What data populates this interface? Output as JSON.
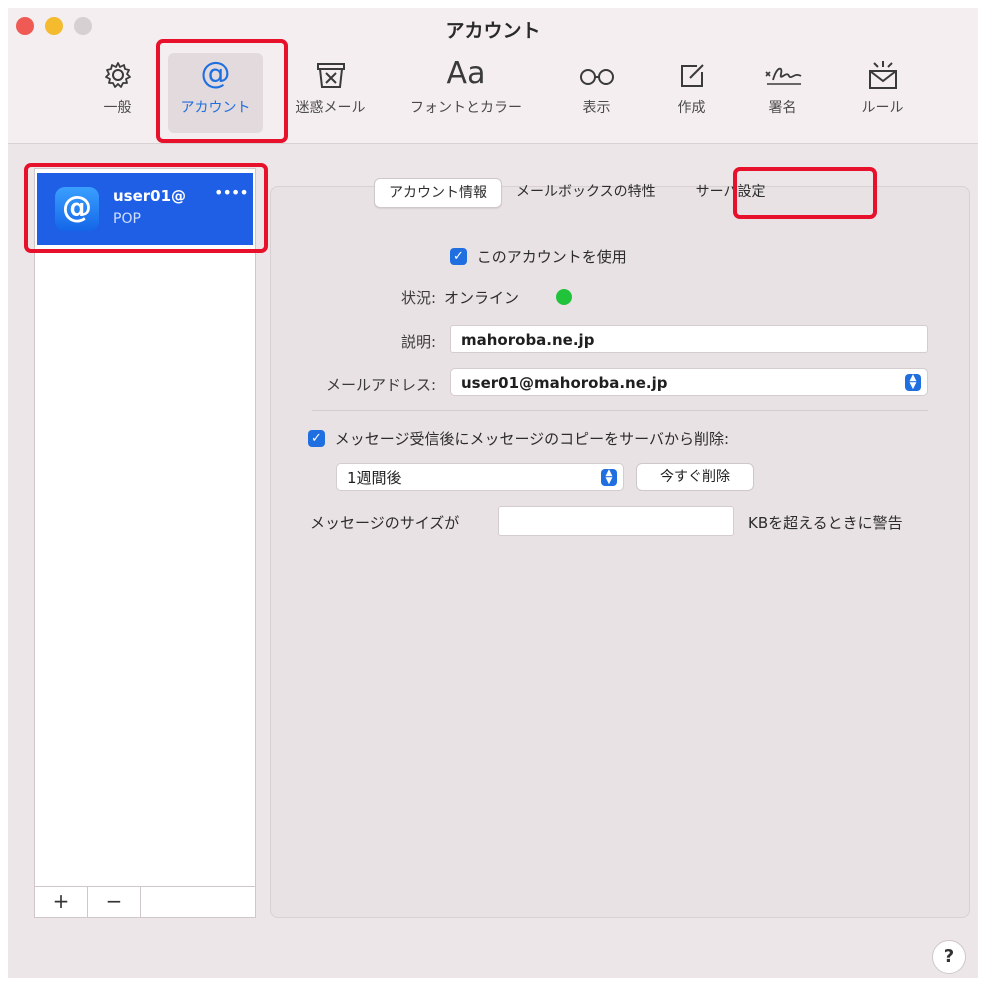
{
  "window": {
    "title": "アカウント"
  },
  "toolbar": {
    "items": [
      {
        "label": "一般",
        "icon": "gear-icon"
      },
      {
        "label": "アカウント",
        "icon": "at-sign-icon",
        "glyph": "@"
      },
      {
        "label": "迷惑メール",
        "icon": "junk-bin-icon"
      },
      {
        "label": "フォントとカラー",
        "icon": "font-icon",
        "glyph": "Aa"
      },
      {
        "label": "表示",
        "icon": "glasses-icon"
      },
      {
        "label": "作成",
        "icon": "compose-icon"
      },
      {
        "label": "署名",
        "icon": "signature-icon"
      },
      {
        "label": "ルール",
        "icon": "rules-envelope-icon"
      }
    ]
  },
  "sidebar": {
    "account": {
      "name": "user01@",
      "type": "POP",
      "dots": "••••",
      "icon_glyph": "@"
    },
    "add_label": "+",
    "remove_label": "−"
  },
  "tabs": [
    {
      "label": "アカウント情報"
    },
    {
      "label": "メールボックスの特性"
    },
    {
      "label": "サーバ設定"
    }
  ],
  "form": {
    "enable_label": "このアカウントを使用",
    "status_label": "状況:",
    "status_value": "オンライン",
    "description_label": "説明:",
    "description_value": "mahoroba.ne.jp",
    "email_label": "メールアドレス:",
    "email_value": "user01@mahoroba.ne.jp",
    "delete_copy_label": "メッセージ受信後にメッセージのコピーをサーバから削除:",
    "period_value": "1週間後",
    "delete_now_label": "今すぐ削除",
    "size_warning_prefix": "メッセージのサイズが",
    "size_warning_suffix": "KBを超えるときに警告",
    "size_value": ""
  },
  "help_label": "?",
  "colors": {
    "accent": "#1f6fe0",
    "highlight_box": "#e8112c",
    "status_online": "#21c33a",
    "selected_row": "#1f5fe6"
  }
}
